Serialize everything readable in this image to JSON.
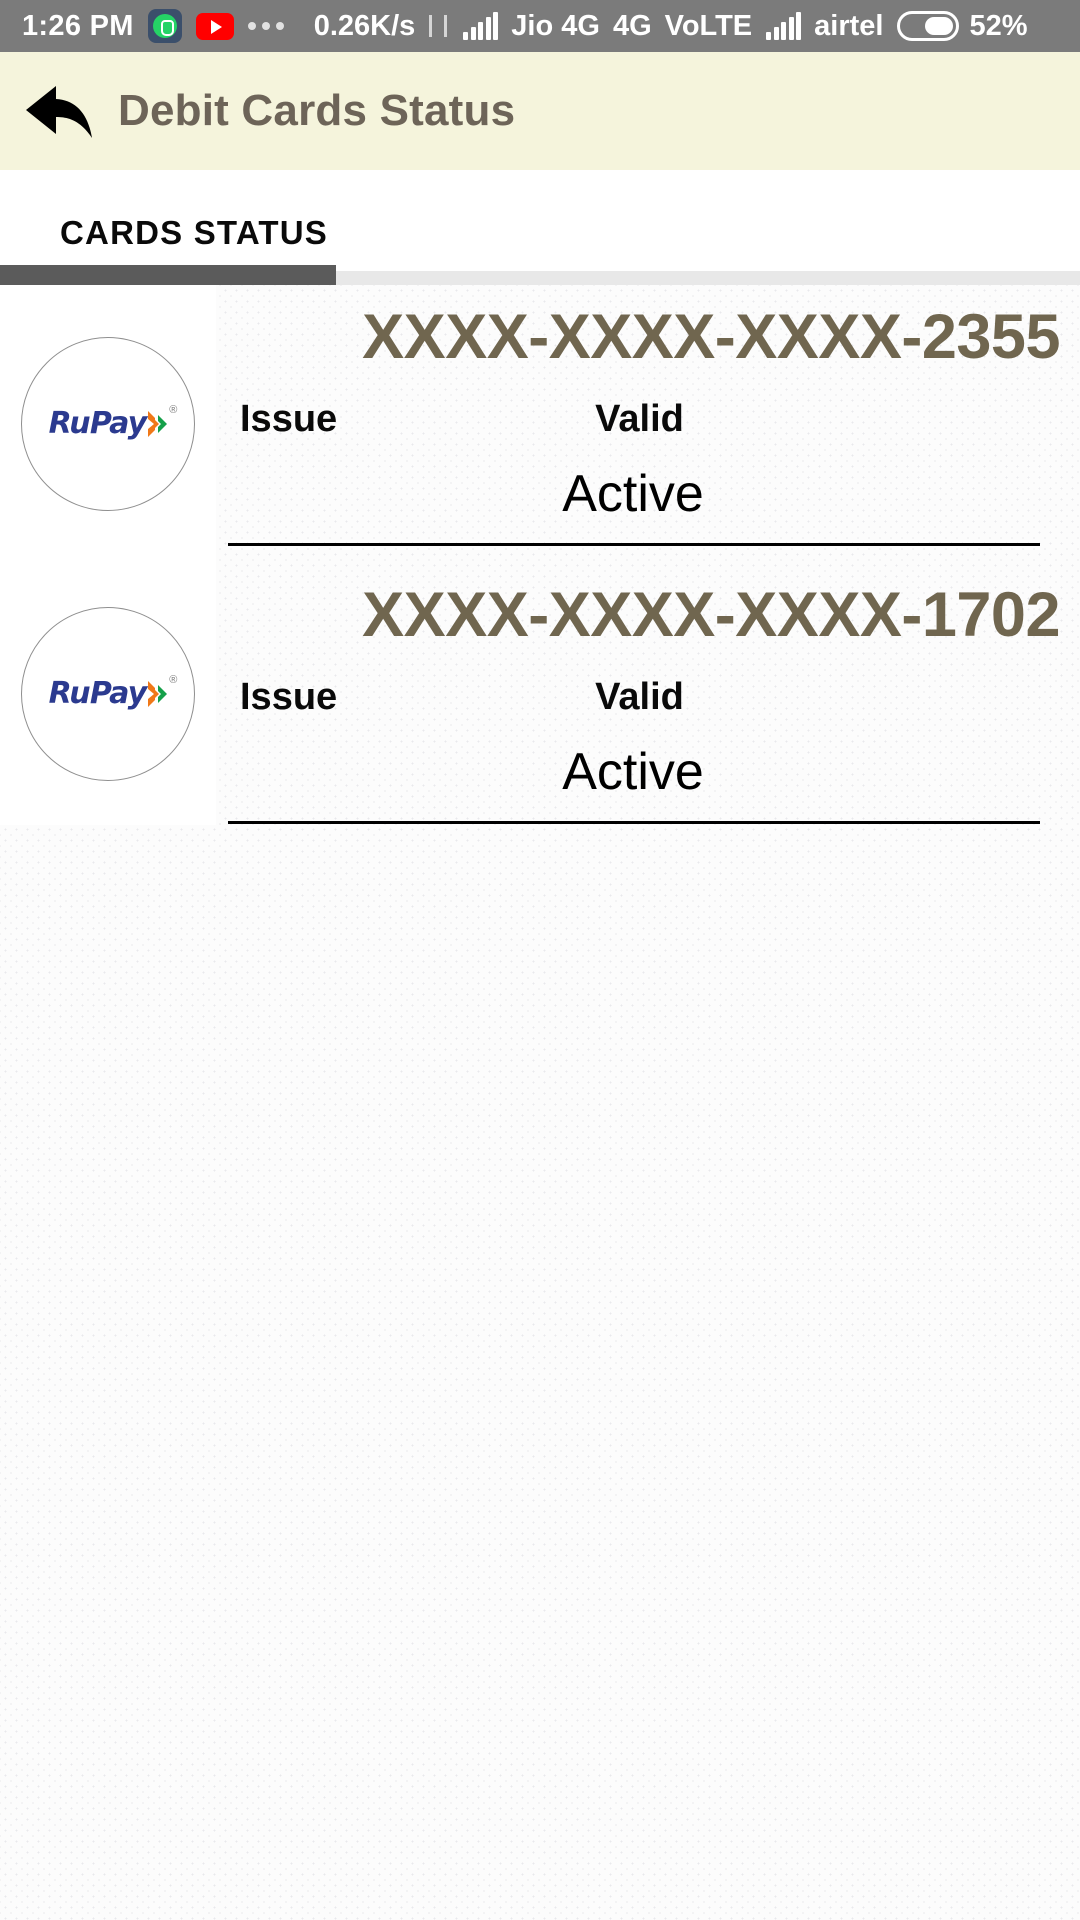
{
  "status_bar": {
    "time": "1:26 PM",
    "app_icons": [
      "whatsapp-icon",
      "youtube-icon",
      "more-notifications-icon"
    ],
    "network_speed": "0.26K/s",
    "data_transfer_icon": "data-transfer-arrows-icon",
    "sim1_signal_icon": "signal-bars-icon",
    "carrier_1": "Jio 4G",
    "network_type": "4G",
    "volte": "VoLTE",
    "sim2_signal_icon": "signal-bars-icon",
    "carrier_2": "airtel",
    "battery_icon": "battery-icon",
    "battery_percent": "52%"
  },
  "app_bar": {
    "back_icon": "back-arrow-icon",
    "title": "Debit Cards Status",
    "background_color": "#f5f4dc",
    "title_color": "#6d6458"
  },
  "tabs": {
    "items": [
      {
        "label": "CARDS STATUS",
        "selected": true
      }
    ],
    "indicator_color": "#5b5b5b",
    "track_color": "#e8e8e8"
  },
  "cards": [
    {
      "brand_logo": "rupay-logo",
      "brand_name": "RuPay",
      "number": "XXXX-XXXX-XXXX-2355",
      "issue_label": "Issue",
      "issue_value": "",
      "valid_label": "Valid",
      "valid_value": "",
      "status": "Active",
      "number_color": "#70664f"
    },
    {
      "brand_logo": "rupay-logo",
      "brand_name": "RuPay",
      "number": "XXXX-XXXX-XXXX-1702",
      "issue_label": "Issue",
      "issue_value": "",
      "valid_label": "Valid",
      "valid_value": "",
      "status": "Active",
      "number_color": "#70664f"
    }
  ]
}
